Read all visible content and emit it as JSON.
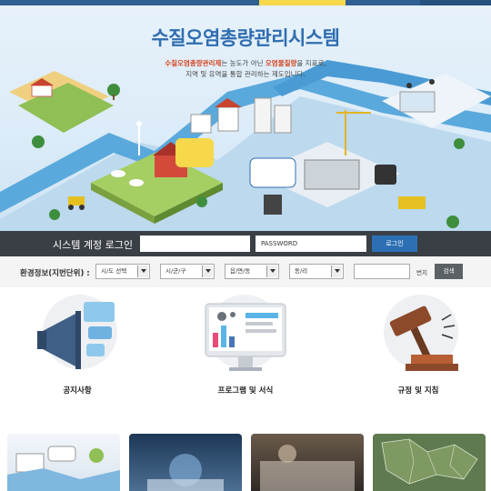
{
  "hero": {
    "title": "수질오염총량관리시스템",
    "desc_prefix": "수질오염총량관리제",
    "desc_mid": "는 농도가 아닌 ",
    "desc_highlight": "오염물질량",
    "desc_suffix": "을 지표로,",
    "desc_line2": "지역 및 유역을 통합 관리하는 제도입니다."
  },
  "login": {
    "label": "시스템 계정 로그인",
    "id_value": "",
    "pw_placeholder": "PASSWORD",
    "button": "로그인"
  },
  "env": {
    "label": "환경정보(지번단위) :",
    "selects": [
      "시/도 선택",
      "시/군/구",
      "읍/면/동",
      "동/리"
    ],
    "lot_label": "번지",
    "search": "검색"
  },
  "quick_menu": [
    {
      "label": "공지사항",
      "icon": "megaphone-icon"
    },
    {
      "label": "프로그램 및 서식",
      "icon": "monitor-chart-icon"
    },
    {
      "label": "규정 및 지침",
      "icon": "gavel-icon"
    }
  ],
  "colors": {
    "brand_blue": "#2f6db0",
    "highlight": "#d6431e",
    "dark_strip": "#3a3f45"
  }
}
